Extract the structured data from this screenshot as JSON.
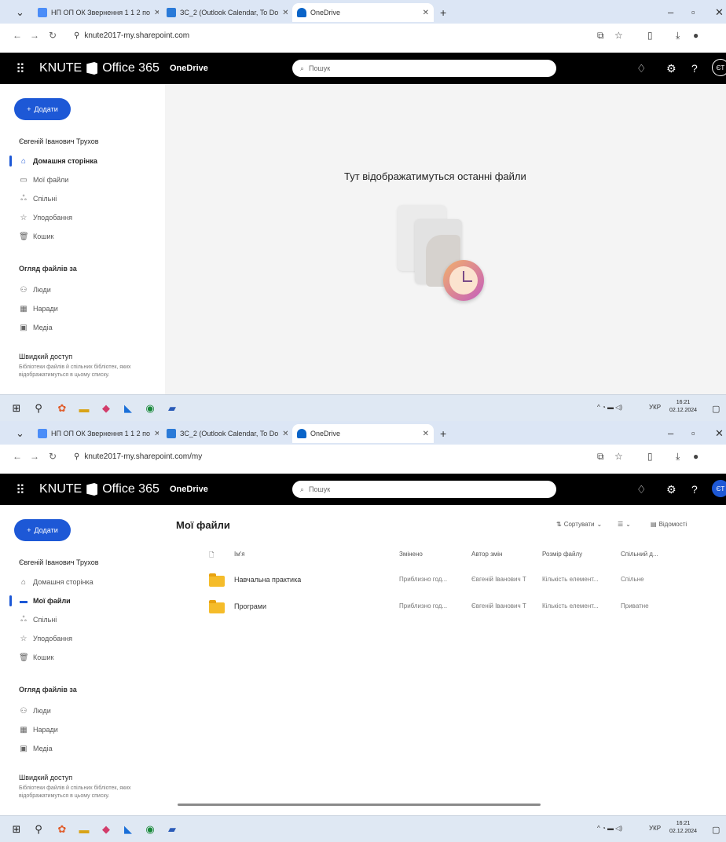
{
  "tabs": [
    {
      "label": "НП ОП ОК Звернення 1 1 2 по"
    },
    {
      "label": "ЗС_2 (Outlook Calendar, To Do"
    },
    {
      "label": "OneDrive"
    }
  ],
  "shots": [
    {
      "url": "knute2017-my.sharepoint.com"
    },
    {
      "url": "knute2017-my.sharepoint.com/my"
    }
  ],
  "header": {
    "brand": "KNUTE",
    "suite": "Office 365",
    "app": "OneDrive",
    "search_placeholder": "Пошук",
    "avatar_initials": "ЄТ"
  },
  "nav": {
    "create_label": "Додати",
    "user": "Євгеній Іванович Трухов",
    "items": [
      "Домашня сторінка",
      "Мої файли",
      "Спільні",
      "Уподобання",
      "Кошик"
    ],
    "browse_heading": "Огляд файлів за",
    "browse_items": [
      "Люди",
      "Наради",
      "Медіа"
    ],
    "quick_heading": "Швидкий доступ",
    "quick_text": "Бібліотеки файлів й спільних бібліотек, яких відображатимуться в цьому списку."
  },
  "home": {
    "empty_title": "Тут відображатимуться останні файли"
  },
  "myfiles": {
    "title": "Мої файли",
    "commands": {
      "sort": "Сортувати",
      "view": "",
      "details": "Відомості"
    },
    "columns": [
      "Ім'я",
      "Змінено",
      "Автор змін",
      "Розмір файлу",
      "Спільний д..."
    ],
    "rows": [
      {
        "name": "Навчальна практика",
        "modified": "Приблизно год...",
        "author": "Євгеній Іванович Т",
        "size": "Кількість елемент...",
        "sharing": "Спільне"
      },
      {
        "name": "Програми",
        "modified": "Приблизно год...",
        "author": "Євгеній Іванович Т",
        "size": "Кількість елемент...",
        "sharing": "Приватне"
      }
    ]
  },
  "taskbar": {
    "time": "16:21",
    "date": "02.12.2024",
    "lang": "УКР"
  }
}
